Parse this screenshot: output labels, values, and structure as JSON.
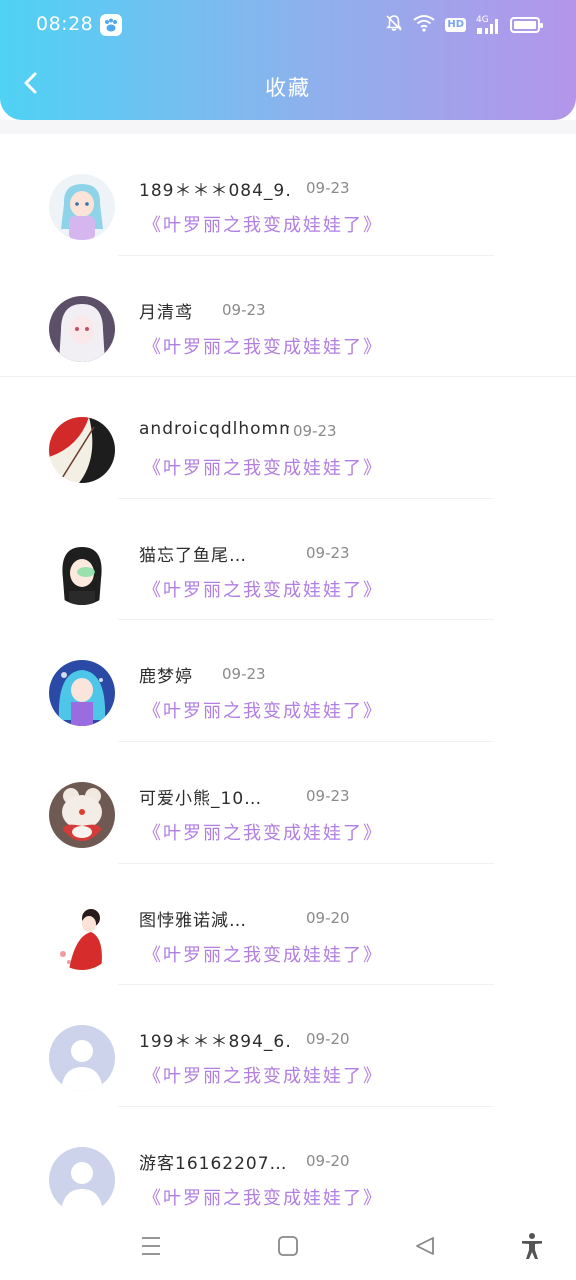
{
  "status_bar": {
    "time": "08:28",
    "hd_badge": "HD",
    "network": "4G"
  },
  "header": {
    "title": "收藏",
    "back_icon": "chevron-left-icon"
  },
  "colors": {
    "header_gradient_start": "#4fd2f5",
    "header_gradient_end": "#b495ea",
    "book_title": "#b17ee2",
    "date": "#8a8a8a"
  },
  "favorites": [
    {
      "name": "189＊＊＊084_9…",
      "date": "09-23",
      "book": "《叶罗丽之我变成娃娃了》",
      "avatar": "anime-girl-blue-hair"
    },
    {
      "name": "月清鸢",
      "date": "09-23",
      "book": "《叶罗丽之我变成娃娃了》",
      "avatar": "anime-girl-white-hair"
    },
    {
      "name": "androicqdlhommew",
      "date": "09-23",
      "book": "《叶罗丽之我变成娃娃了》",
      "avatar": "red-umbrella"
    },
    {
      "name": "猫忘了鱼尾…",
      "date": "09-23",
      "book": "《叶罗丽之我变成娃娃了》",
      "avatar": "girl-green-glasses"
    },
    {
      "name": "鹿梦婷",
      "date": "09-23",
      "book": "《叶罗丽之我变成娃娃了》",
      "avatar": "anime-girl-teal-hair"
    },
    {
      "name": "可爱小熊_10…",
      "date": "09-23",
      "book": "《叶罗丽之我变成娃娃了》",
      "avatar": "toy-bear"
    },
    {
      "name": "图悖雅诺減…",
      "date": "09-20",
      "book": "《叶罗丽之我变成娃娃了》",
      "avatar": "girl-red-dress"
    },
    {
      "name": "199＊＊＊894_6…",
      "date": "09-20",
      "book": "《叶罗丽之我变成娃娃了》",
      "avatar": "default-user"
    },
    {
      "name": "游客16162207…",
      "date": "09-20",
      "book": "《叶罗丽之我变成娃娃了》",
      "avatar": "default-user"
    }
  ],
  "bottom_nav": {
    "menu_icon": "menu-icon",
    "home_icon": "home-icon",
    "back_icon": "back-triangle-icon",
    "accessibility_icon": "accessibility-icon"
  }
}
